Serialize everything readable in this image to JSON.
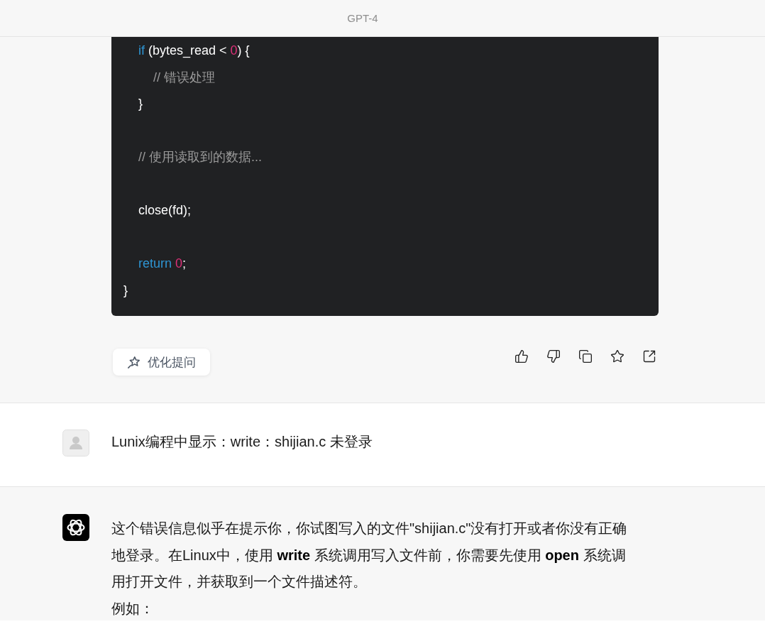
{
  "header": {
    "title": "GPT-4"
  },
  "messages": [
    {
      "kind": "assistant",
      "clipped_top": true,
      "code": {
        "lines": [
          {
            "kind": "block",
            "children": [
              {
                "kind": "line",
                "tokens": [
                  {
                    "kind": "keyword",
                    "text": "if"
                  },
                  {
                    "kind": "plain",
                    "text": " (bytes_read < "
                  },
                  {
                    "kind": "number",
                    "text": "0"
                  },
                  {
                    "kind": "plain",
                    "text": ") {"
                  }
                ],
                "children": [
                  {
                    "kind": "line",
                    "tokens": [
                      {
                        "kind": "comment",
                        "text": "// 错误处理"
                      }
                    ]
                  }
                ]
              },
              {
                "kind": "line",
                "tokens": [
                  {
                    "kind": "plain",
                    "text": "}"
                  }
                ]
              },
              {
                "kind": "blank"
              },
              {
                "kind": "line",
                "tokens": [
                  {
                    "kind": "comment",
                    "text": "// 使用读取到的数据..."
                  }
                ]
              },
              {
                "kind": "blank"
              },
              {
                "kind": "line",
                "tokens": [
                  {
                    "kind": "plain",
                    "text": "close(fd);"
                  }
                ]
              },
              {
                "kind": "blank"
              },
              {
                "kind": "line",
                "tokens": [
                  {
                    "kind": "keyword",
                    "text": "return "
                  },
                  {
                    "kind": "number",
                    "text": "0"
                  },
                  {
                    "kind": "plain",
                    "text": ";"
                  }
                ]
              }
            ]
          },
          {
            "kind": "line",
            "tokens": [
              {
                "kind": "plain",
                "text": "}"
              }
            ]
          }
        ]
      },
      "actions": {
        "button": {
          "label": "优化提问"
        }
      }
    },
    {
      "kind": "user",
      "clipped_top": false,
      "paragraphs": [
        "Lunix编程中显示：write：shijian.c 未登录"
      ]
    },
    {
      "kind": "assistant",
      "clipped_top": false,
      "paragraphs": [
        "这个错误信息似乎在提示你，你试图写入的文件\"shijian.c\"没有打开或者你没有正确地登录。在Linux中，使用 **write** 系统调用写入文件前，你需要先使用 **open** 系统调用打开文件，并获取到一个文件描述符。",
        "例如："
      ]
    }
  ]
}
